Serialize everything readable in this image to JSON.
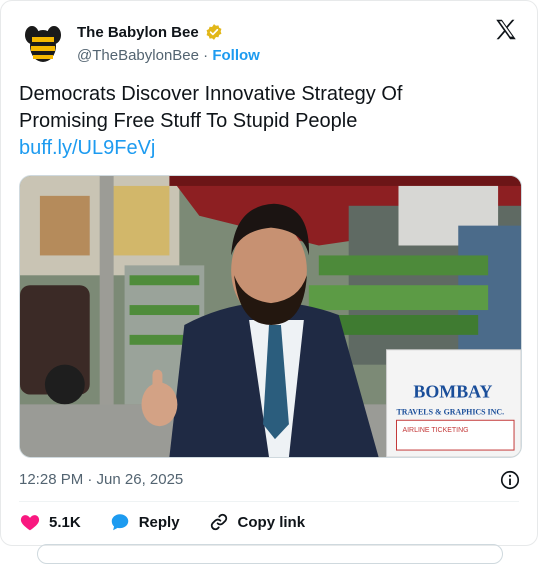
{
  "account": {
    "name": "The Babylon Bee",
    "handle": "@TheBabylonBee",
    "separator": "·",
    "follow_label": "Follow"
  },
  "tweet": {
    "line1": "Democrats Discover Innovative Strategy Of",
    "line2": "Promising Free Stuff To Stupid People",
    "link": "buff.ly/UL9FeVj"
  },
  "media": {
    "sign_line1": "BOMBAY",
    "sign_line2": "TRAVELS & GRAPHICS INC.",
    "sign_line3": "AIRLINE TICKETING"
  },
  "meta": {
    "timestamp": "12:28 PM · Jun 26, 2025"
  },
  "actions": {
    "likes": "5.1K",
    "reply": "Reply",
    "copy_link": "Copy link"
  },
  "colors": {
    "accent": "#1d9bf0",
    "like": "#f91880",
    "text": "#0f1419",
    "secondary": "#536471"
  }
}
